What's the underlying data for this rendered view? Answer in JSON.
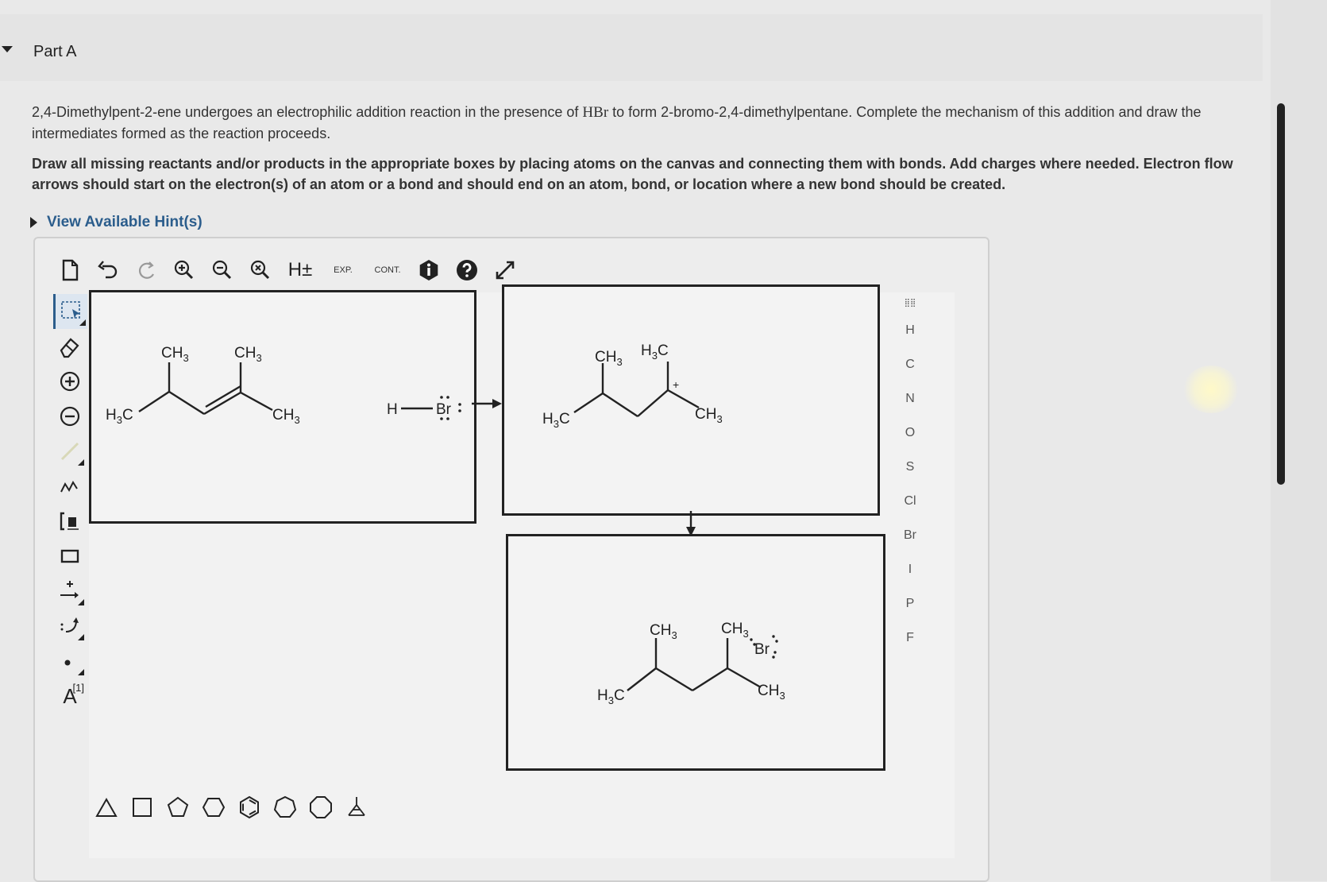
{
  "part": {
    "title": "Part A"
  },
  "intro": {
    "text_before": "2,4-Dimethylpent-2-ene undergoes an electrophilic addition reaction in the presence of ",
    "reagent": "HBr",
    "text_after": " to form 2-bromo-2,4-dimethylpentane. Complete the mechanism of this addition and draw the intermediates formed as the reaction proceeds."
  },
  "instructions": "Draw all missing reactants and/or products in the appropriate boxes by placing atoms on the canvas and connecting them with bonds. Add charges where needed. Electron flow arrows should start on the electron(s) of an atom or a bond and should end on an atom, bond, or location where a new bond should be created.",
  "hints": {
    "label": "View Available Hint(s)"
  },
  "toolbar_top": {
    "h_toggle": "H±",
    "exp_label": "EXP.",
    "cont_label": "CONT."
  },
  "toolbar_left": {
    "text_tool_label": "A",
    "text_tool_sup": "[1]"
  },
  "elements": [
    "H",
    "C",
    "N",
    "O",
    "S",
    "Cl",
    "Br",
    "I",
    "P",
    "F"
  ],
  "element_grid_label": "⣿⣿",
  "molecules": {
    "reactant": {
      "ch3": "CH",
      "sub3": "3",
      "h3c": "H",
      "c": "C"
    },
    "reagent": {
      "h": "H",
      "br": "Br",
      "lone_pairs": ":"
    },
    "carbocation": {
      "charge": "+"
    },
    "product": {
      "br": "Br"
    }
  }
}
